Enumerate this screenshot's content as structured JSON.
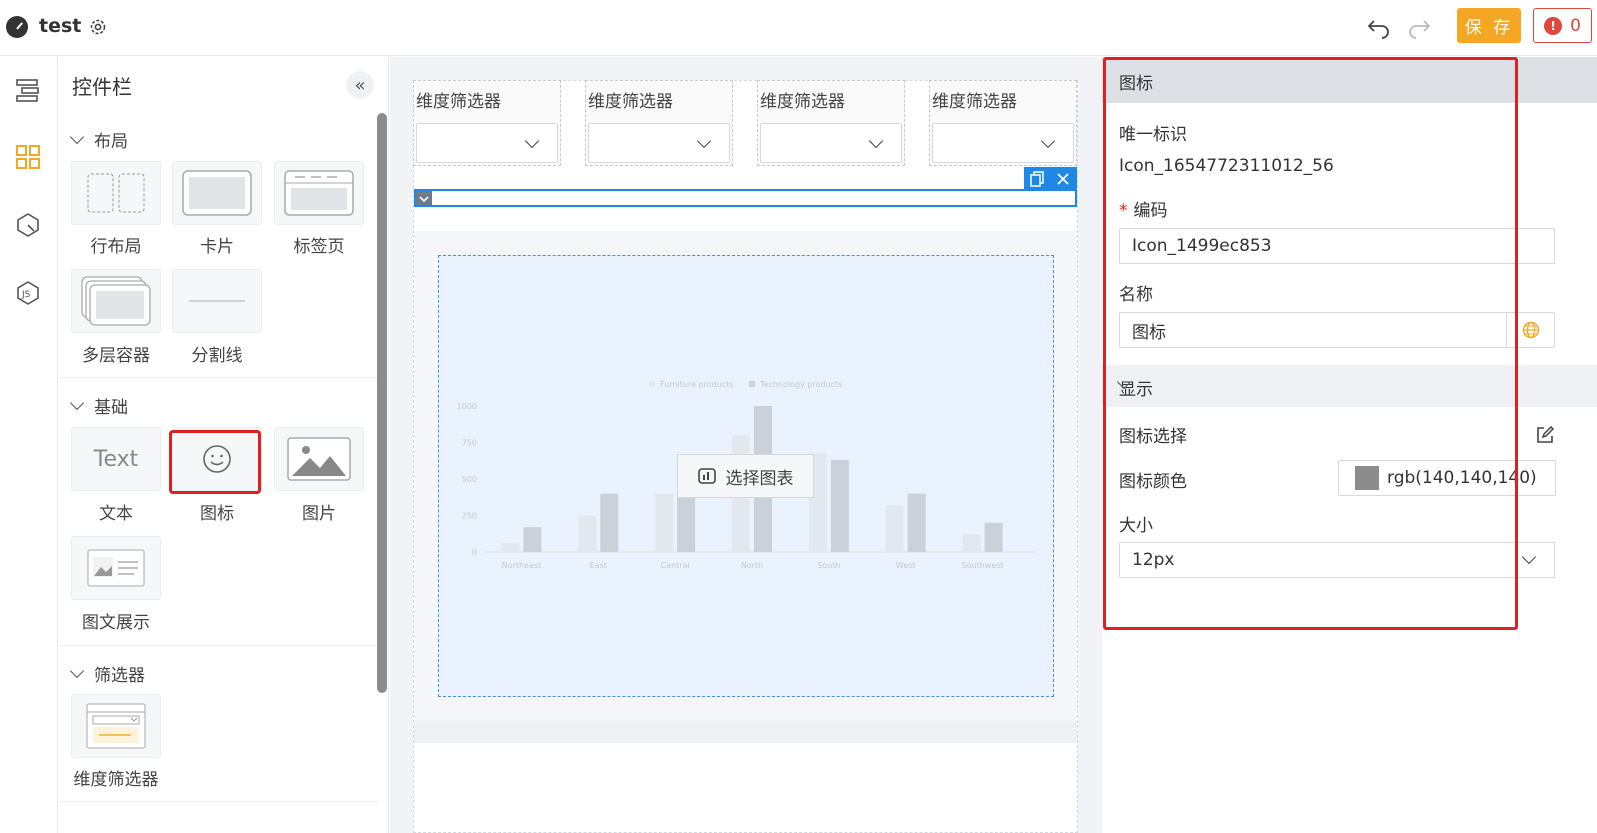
{
  "header": {
    "app_title": "test",
    "save_label": "保 存",
    "error_count": "0",
    "error_glyph": "!"
  },
  "panel": {
    "title": "控件栏",
    "collapse_glyph": "«",
    "groups": {
      "layout": {
        "title": "布局",
        "items": [
          "行布局",
          "卡片",
          "标签页",
          "多层容器",
          "分割线"
        ]
      },
      "basic": {
        "title": "基础",
        "items": [
          "文本",
          "图标",
          "图片",
          "图文展示"
        ],
        "text_tile_preview": "Text"
      },
      "filter": {
        "title": "筛选器",
        "items": [
          "维度筛选器"
        ]
      }
    }
  },
  "canvas": {
    "filter_label": "维度筛选器",
    "choose_chart_label": "选择图表",
    "chart_legend": [
      "Furniture products",
      "Technology products"
    ]
  },
  "chart_data": {
    "type": "bar",
    "title": "",
    "categories": [
      "Northeast",
      "East",
      "Central",
      "North",
      "South",
      "West",
      "Southwest"
    ],
    "series": [
      {
        "name": "Furniture products",
        "values": [
          60,
          250,
          400,
          800,
          680,
          320,
          120
        ]
      },
      {
        "name": "Technology products",
        "values": [
          170,
          400,
          380,
          1000,
          630,
          400,
          200
        ]
      }
    ],
    "yticks": [
      "0",
      "250",
      "500",
      "750",
      "1000"
    ],
    "ylim": [
      0,
      1000
    ]
  },
  "props": {
    "section_title": "图标",
    "unique_id_label": "唯一标识",
    "unique_id_value": "Icon_1654772311012_56",
    "code_label": "编码",
    "code_required": "*",
    "code_value": "Icon_1499ec853",
    "name_label": "名称",
    "name_value": "图标",
    "display_section": "显示",
    "icon_select_label": "图标选择",
    "icon_color_label": "图标颜色",
    "icon_color_value": "rgb(140,140,140)",
    "size_label": "大小",
    "size_value": "12px"
  },
  "colors": {
    "accent_blue": "#1e88e5",
    "save_orange": "#f5a623",
    "error_red": "#e0463c",
    "highlight_red": "#e02020",
    "icon_color": "#8c8c8c"
  }
}
